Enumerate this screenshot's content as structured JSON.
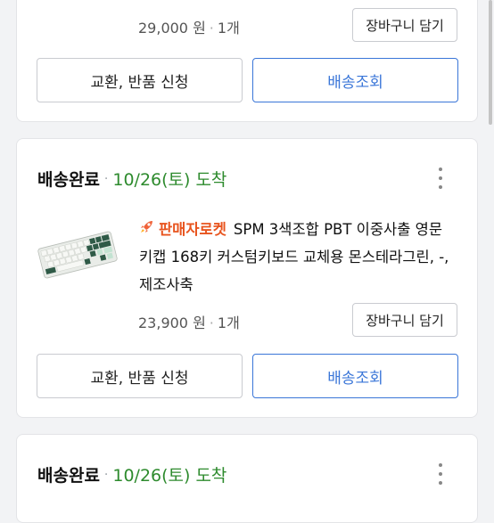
{
  "orders": [
    {
      "price": "29,000 원",
      "qty": "1개",
      "cart_label": "장바구니 담기",
      "return_label": "교환, 반품 신청",
      "track_label": "배송조회"
    },
    {
      "status": "배송완료",
      "date": "10/26(토)",
      "arrive": "도착",
      "rocket_label": "판매자로켓",
      "product_name": "SPM 3색조합 PBT 이중사출 영문 키캡 168키 커스텀키보드 교체용 몬스테라그린, -, 제조사축",
      "price": "23,900 원",
      "qty": "1개",
      "cart_label": "장바구니 담기",
      "return_label": "교환, 반품 신청",
      "track_label": "배송조회"
    },
    {
      "status": "배송완료",
      "date": "10/26(토)",
      "arrive": "도착"
    }
  ],
  "colors": {
    "accent_blue": "#3a76d8",
    "status_green": "#2e8b2e",
    "rocket_orange": "#e8541e"
  },
  "icons": {
    "more": "more-vertical-icon",
    "rocket": "rocket-icon"
  }
}
